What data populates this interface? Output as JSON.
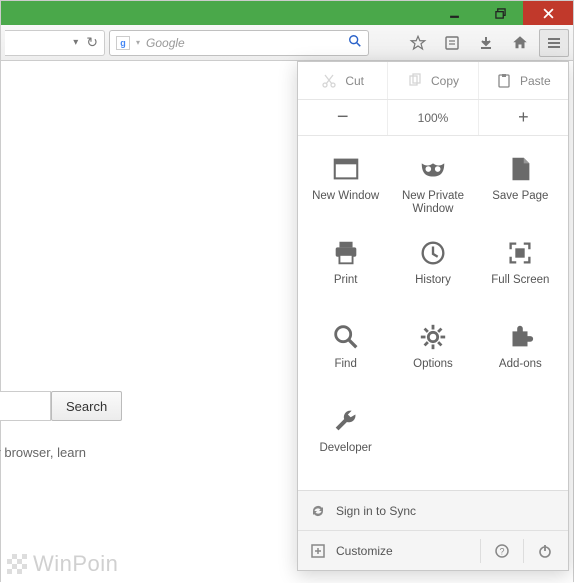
{
  "window_controls": {
    "minimize": "minimize",
    "maximize": "restore",
    "close": "close"
  },
  "toolbar": {
    "reload_tooltip": "Reload",
    "search_provider": "Google",
    "search_placeholder": "Google",
    "star_tooltip": "Bookmark",
    "reading_tooltip": "Reading List",
    "downloads_tooltip": "Downloads",
    "home_tooltip": "Home",
    "menu_tooltip": "Open menu"
  },
  "page": {
    "search_button": "Search",
    "tip_text": "of your browser, learn",
    "watermark": "WinPoin"
  },
  "menu": {
    "edit": {
      "cut": "Cut",
      "copy": "Copy",
      "paste": "Paste"
    },
    "zoom": {
      "out": "−",
      "level": "100%",
      "in": "+"
    },
    "items": [
      {
        "id": "new-window",
        "label": "New Window"
      },
      {
        "id": "new-private-window",
        "label": "New Private\nWindow"
      },
      {
        "id": "save-page",
        "label": "Save Page"
      },
      {
        "id": "print",
        "label": "Print"
      },
      {
        "id": "history",
        "label": "History"
      },
      {
        "id": "full-screen",
        "label": "Full Screen"
      },
      {
        "id": "find",
        "label": "Find"
      },
      {
        "id": "options",
        "label": "Options"
      },
      {
        "id": "addons",
        "label": "Add-ons"
      },
      {
        "id": "developer",
        "label": "Developer"
      }
    ],
    "sync": "Sign in to Sync",
    "customize": "Customize",
    "help": "Help",
    "quit": "Quit"
  }
}
